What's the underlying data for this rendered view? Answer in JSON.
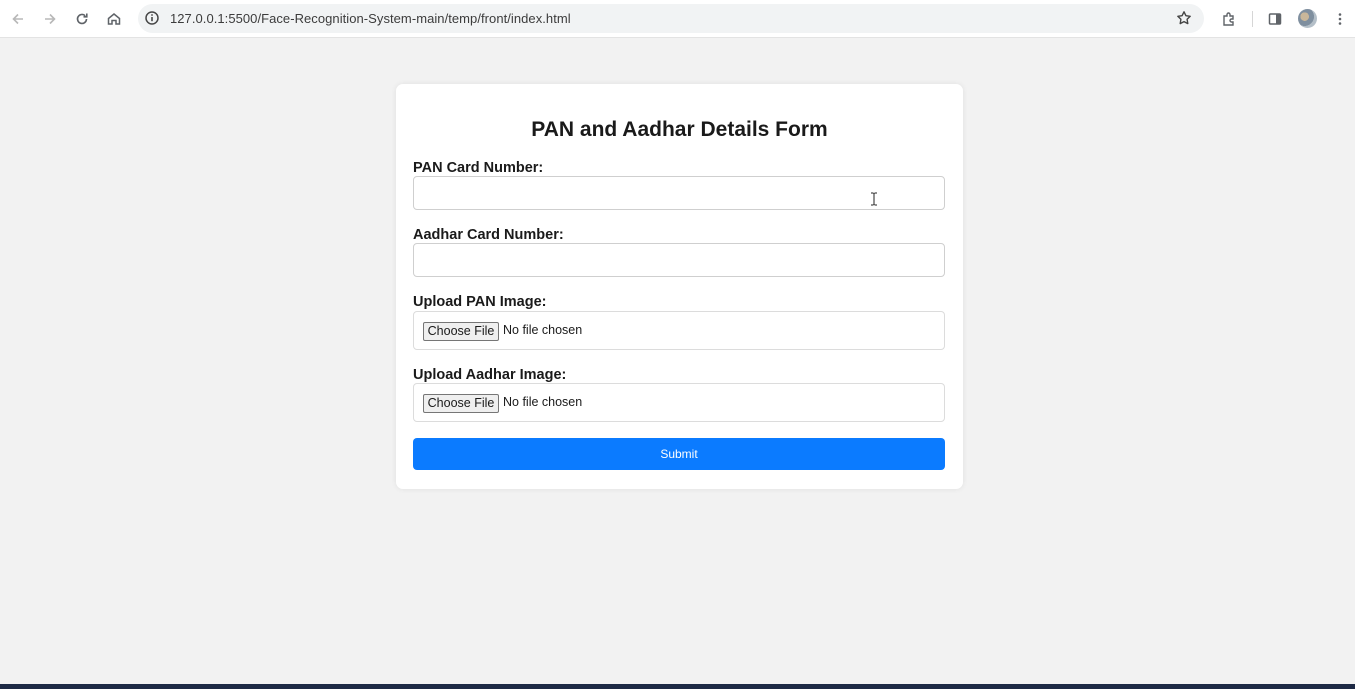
{
  "browser": {
    "url": "127.0.0.1:5500/Face-Recognition-System-main/temp/front/index.html"
  },
  "form": {
    "title": "PAN and Aadhar Details Form",
    "pan_label": "PAN Card Number:",
    "pan_value": "",
    "aadhar_label": "Aadhar Card Number:",
    "aadhar_value": "",
    "pan_image_label": "Upload PAN Image:",
    "aadhar_image_label": "Upload Aadhar Image:",
    "choose_file_label": "Choose File",
    "no_file_text": "No file chosen",
    "submit_label": "Submit"
  },
  "colors": {
    "accent": "#0b7bff",
    "page_background": "#f2f2f2"
  }
}
